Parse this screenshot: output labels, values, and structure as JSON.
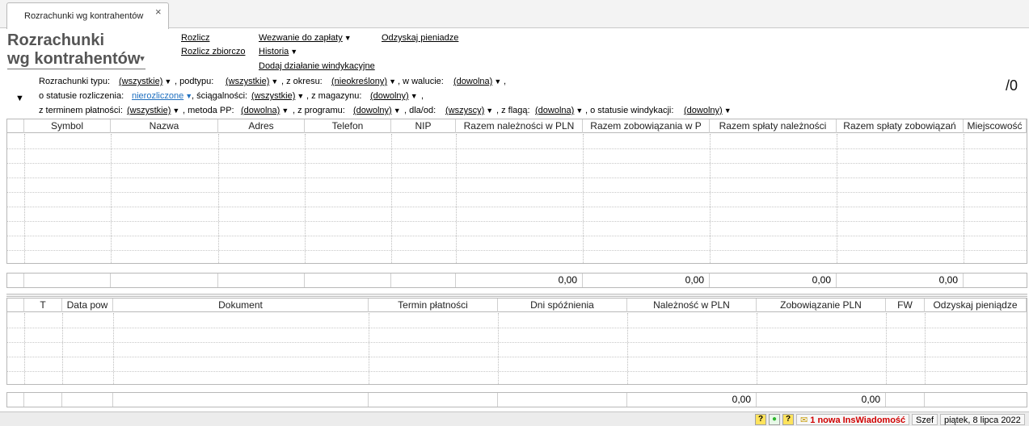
{
  "tab": {
    "label": "Rozrachunki wg kontrahentów",
    "close": "×"
  },
  "header": {
    "title_line1": "Rozrachunki",
    "title_line2": "wg kontrahentów",
    "actions": {
      "rozlicz": "Rozlicz",
      "rozlicz_zbiorczo": "Rozlicz zbiorczo",
      "wezwanie": "Wezwanie do zapłaty",
      "historia": "Historia",
      "dodaj": "Dodaj działanie windykacyjne",
      "odzyskaj": "Odzyskaj pieniadze"
    },
    "counter": "/0"
  },
  "filters": {
    "toggle": "▼",
    "typu_label": "Rozrachunki typu:",
    "typu_value": "(wszystkie)",
    "podtypu_label": ", podtypu:",
    "podtypu_value": "(wszystkie)",
    "okresu_label": ", z okresu:",
    "okresu_value": "(nieokreślony)",
    "waluta_label": ", w walucie:",
    "waluta_value": "(dowolna)",
    "waluta_end": ",",
    "status_label": "o statusie rozliczenia:",
    "status_value": "nierozliczone",
    "sciag_label": ", ściągalności:",
    "sciag_value": "(wszystkie)",
    "magazyn_label": ", z magazynu:",
    "magazyn_value": "(dowolny)",
    "magazyn_end": ",",
    "termin_label": "z terminem płatności:",
    "termin_value": "(wszystkie)",
    "metoda_label": ", metoda PP:",
    "metoda_value": "(dowolna)",
    "program_label": ", z programu:",
    "program_value": "(dowolny)",
    "dlaod_label": ", dla/od:",
    "dlaod_value": "(wszyscy)",
    "flaga_label": ", z flagą:",
    "flaga_value": "(dowolna)",
    "windyk_label": ", o statusie windykacji:",
    "windyk_value": "(dowolny)"
  },
  "top_table": {
    "columns": [
      "",
      "Symbol",
      "Nazwa",
      "Adres",
      "Telefon",
      "NIP",
      "Razem należności w PLN",
      "Razem zobowiązania w P",
      "Razem spłaty należności",
      "Razem spłaty zobowiązań",
      "Miejscowość"
    ],
    "sums": [
      "0,00",
      "0,00",
      "0,00",
      "0,00"
    ]
  },
  "bottom_table": {
    "columns": [
      "",
      "T",
      "Data pow",
      "Dokument",
      "Termin płatności",
      "Dni spóźnienia",
      "Należność w PLN",
      "Zobowiązanie PLN",
      "FW",
      "Odzyskaj pieniądze"
    ],
    "sums": [
      "0,00",
      "0,00"
    ]
  },
  "statusbar": {
    "help1": "?",
    "dot": "●",
    "help2": "?",
    "mail": "✉",
    "message": "1 nowa InsWiadomość",
    "user": "Szef",
    "date": "piątek, 8 lipca 2022"
  }
}
